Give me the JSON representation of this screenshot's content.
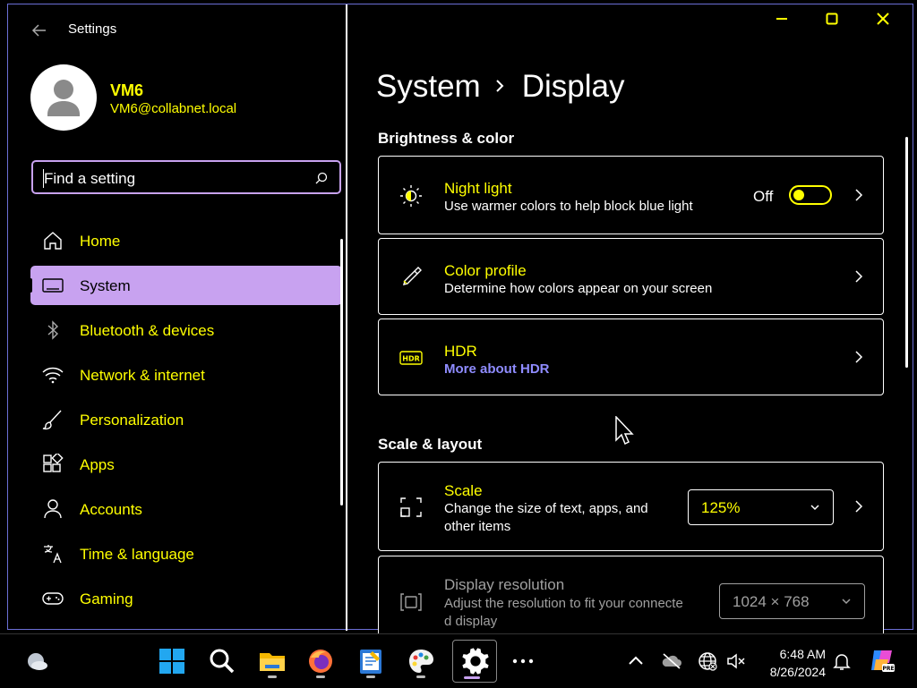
{
  "window": {
    "app_title": "Settings",
    "controls": {
      "minimize": "minimize-icon",
      "maximize": "maximize-icon",
      "close": "close-icon"
    }
  },
  "user": {
    "name": "VM6",
    "email": "VM6@collabnet.local"
  },
  "search": {
    "placeholder": "Find a setting"
  },
  "nav": [
    {
      "label": "Home",
      "icon": "home-icon"
    },
    {
      "label": "System",
      "icon": "laptop-icon",
      "selected": true
    },
    {
      "label": "Bluetooth & devices",
      "icon": "bluetooth-icon"
    },
    {
      "label": "Network & internet",
      "icon": "wifi-icon"
    },
    {
      "label": "Personalization",
      "icon": "brush-icon"
    },
    {
      "label": "Apps",
      "icon": "apps-icon"
    },
    {
      "label": "Accounts",
      "icon": "person-icon"
    },
    {
      "label": "Time & language",
      "icon": "time-language-icon"
    },
    {
      "label": "Gaming",
      "icon": "gamepad-icon"
    }
  ],
  "breadcrumb": {
    "parent": "System",
    "current": "Display"
  },
  "sections": {
    "brightness": "Brightness & color",
    "scale_layout": "Scale & layout"
  },
  "cards": {
    "night_light": {
      "title": "Night light",
      "desc": "Use warmer colors to help block blue light",
      "toggle_label": "Off",
      "toggle_on": false
    },
    "color_profile": {
      "title": "Color profile",
      "desc": "Determine how colors appear on your screen"
    },
    "hdr": {
      "title": "HDR",
      "link": "More about HDR"
    },
    "scale": {
      "title": "Scale",
      "desc_line1": "Change the size of text, apps, and",
      "desc_line2": "other items",
      "value": "125%"
    },
    "resolution": {
      "title": "Display resolution",
      "desc_line1": "Adjust the resolution to fit your connecte",
      "desc_line2": "d display",
      "value": "1024 × 768"
    }
  },
  "taskbar": {
    "apps": [
      "weather-icon",
      "start-icon",
      "search-icon",
      "file-explorer-icon",
      "firefox-icon",
      "notepad-icon",
      "paint-icon",
      "settings-icon",
      "more-icon"
    ],
    "tray": [
      "chevron-up-icon",
      "onedrive-icon",
      "network-icon",
      "volume-muted-icon"
    ],
    "time": "6:48 AM",
    "date": "8/26/2024"
  },
  "colors": {
    "accent": "#c8a2f0",
    "text_highlight": "#ffff00",
    "link": "#8f8cff",
    "background": "#000000"
  }
}
